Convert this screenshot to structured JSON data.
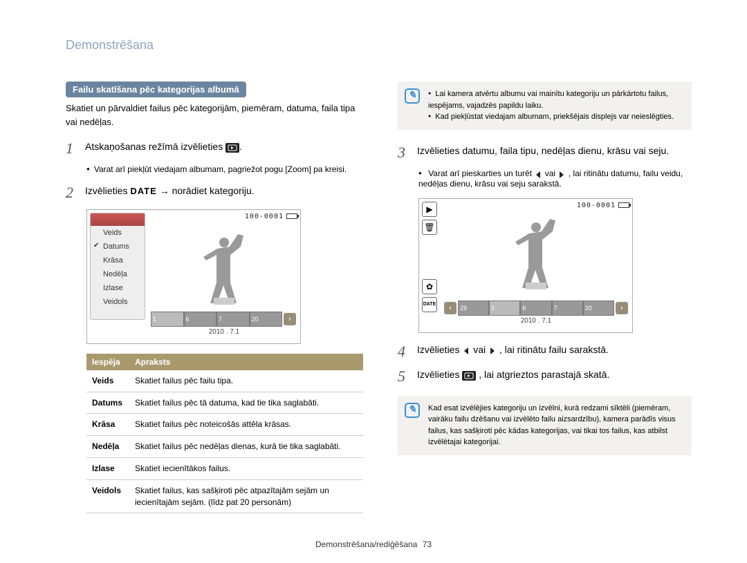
{
  "page_title": "Demonstrēšana",
  "section_label": "Failu skatīšana pēc kategorijas albumā",
  "intro": "Skatiet un pārvaldiet failus pēc kategorijām, piemēram, datuma, faila tipa vai nedēļas.",
  "step1": {
    "text_a": "Atskaņošanas režīmā izvēlieties ",
    "bullet": "Varat arī piekļūt viedajam albumam, pagriežot pogu [Zoom] pa kreisi."
  },
  "step2": {
    "text_a": "Izvēlieties ",
    "date_caps": "DATE",
    "text_b": " → norādiet kategoriju."
  },
  "screenshot1": {
    "topbar": "100-0001",
    "menu": [
      "Veids",
      "Datums",
      "Krāsa",
      "Nedēļa",
      "Izlase",
      "Veidols"
    ],
    "selected_index": 1,
    "thumbs": [
      "1",
      "6",
      "7",
      "20"
    ],
    "date": "2010 . 7.1"
  },
  "options_table": {
    "headers": [
      "Iespēja",
      "Apraksts"
    ],
    "rows": [
      [
        "Veids",
        "Skatiet failus pēc failu tipa."
      ],
      [
        "Datums",
        "Skatiet failus pēc tā datuma, kad tie tika saglabāti."
      ],
      [
        "Krāsa",
        "Skatiet failus pēc noteicošās attēla krāsas."
      ],
      [
        "Nedēļa",
        "Skatiet failus pēc nedēļas dienas, kurā tie tika saglabāti."
      ],
      [
        "Izlase",
        "Skatiet iecienītākos failus."
      ],
      [
        "Veidols",
        "Skatiet failus, kas sašķiroti pēc atpazītajām sejām un iecienītajām sejām. (līdz pat 20 personām)"
      ]
    ]
  },
  "note1": {
    "items": [
      "Lai kamera atvērtu albumu vai mainītu kategoriju un pārkārtotu failus, iespējams, vajadzēs papildu laiku.",
      "Kad piekļūstat viedajam albumam, priekšējais displejs var neieslēgties."
    ]
  },
  "step3": {
    "text_a": "Izvēlieties datumu, faila tipu, nedēļas dienu, krāsu vai seju.",
    "bullet_a": "Varat arī pieskarties un turēt ",
    "bullet_b": " vai ",
    "bullet_c": ", lai ritinātu datumu, failu veidu, nedēļas dienu, krāsu vai seju sarakstā."
  },
  "screenshot2": {
    "topbar": "100-0001",
    "thumbs": [
      "29",
      "1",
      "6",
      "7",
      "20"
    ],
    "date": "2010 . 7.1",
    "icons_desc": [
      "play",
      "trash",
      "gear",
      "date"
    ]
  },
  "step4": {
    "text_a": "Izvēlieties ",
    "text_b": " vai ",
    "text_c": ", lai ritinātu failu sarakstā."
  },
  "step5": {
    "text_a": "Izvēlieties ",
    "text_b": ", lai atgrieztos parastajā skatā."
  },
  "note2": {
    "text": "Kad esat izvēlējies kategoriju un izvēlni, kurā redzami sīktēli (piemēram, vairāku failu dzēšanu vai izvēlēto failu aizsardzību), kamera parādīs visus failus, kas sašķiroti pēc kādas kategorijas, vai tikai tos failus, kas atbilst izvēlētajai kategorijai."
  },
  "footer": {
    "section": "Demonstrēšana/rediģēšana",
    "page": "73"
  }
}
